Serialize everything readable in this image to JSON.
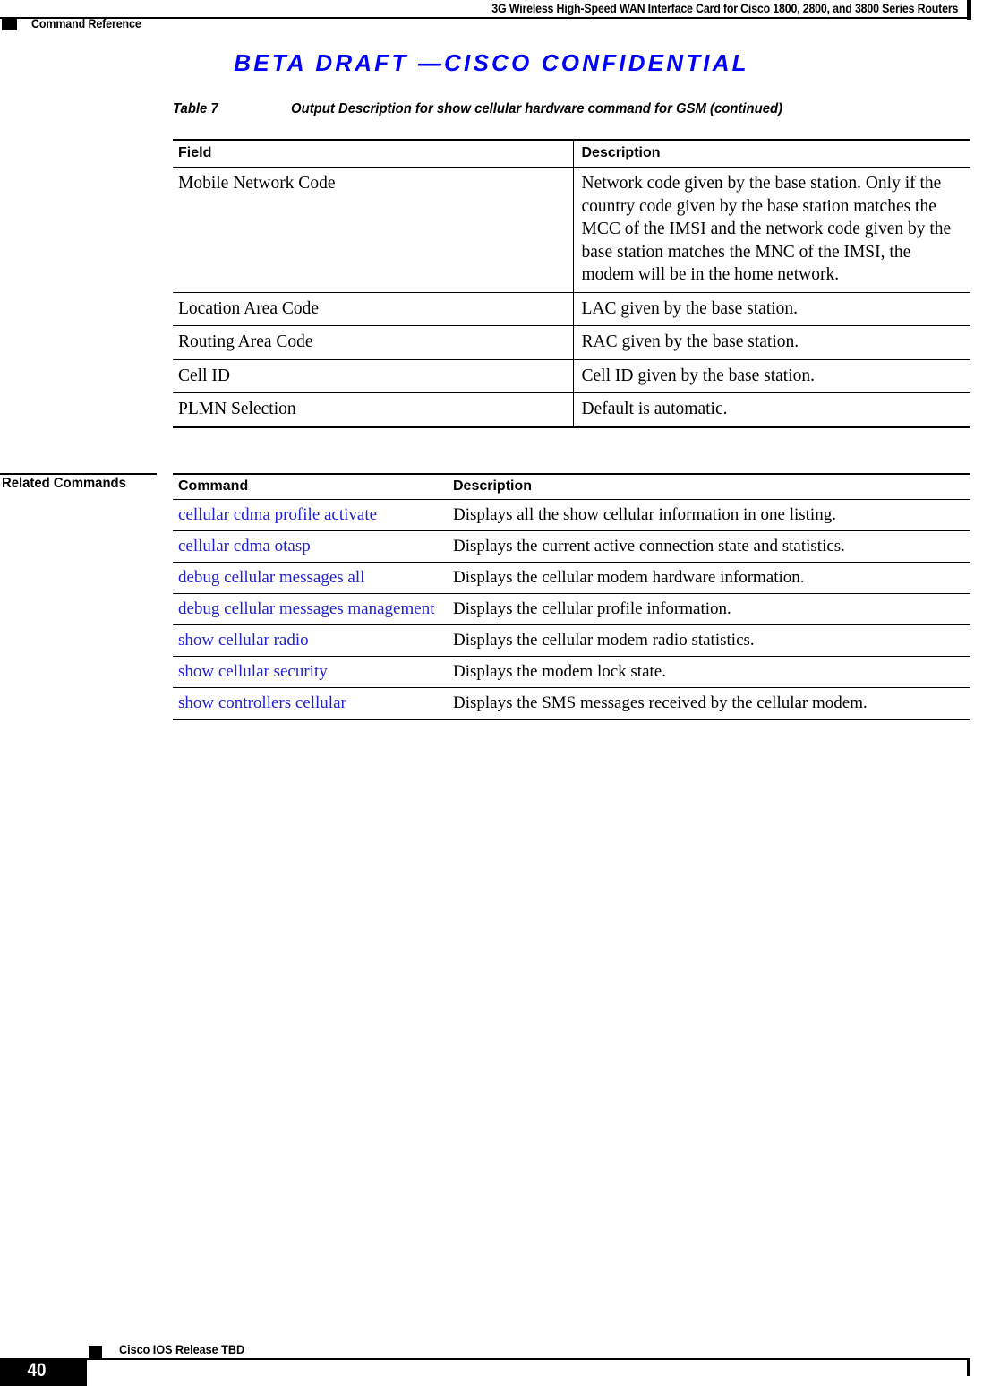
{
  "header": {
    "document_title": "3G Wireless High-Speed WAN Interface Card for Cisco 1800, 2800, and 3800 Series Routers",
    "chapter_label": "Command Reference"
  },
  "banner": {
    "text": "BETA DRAFT —CISCO CONFIDENTIAL",
    "color": "#0000FF"
  },
  "table_caption": {
    "number": "Table 7",
    "title": "Output Description for show cellular hardware command for GSM (continued)"
  },
  "field_table": {
    "columns": [
      "Field",
      "Description"
    ],
    "rows": [
      {
        "field": "Mobile Network Code",
        "description": "Network code given by the base station. Only if the country code given by the base station matches the MCC of the IMSI and the network code given by the base station matches the MNC of the IMSI, the modem will be in the home network."
      },
      {
        "field": "Location Area Code",
        "description": "LAC given by the base station."
      },
      {
        "field": "Routing Area Code",
        "description": "RAC given by the base station."
      },
      {
        "field": "Cell ID",
        "description": "Cell ID given by the base station."
      },
      {
        "field": "PLMN Selection",
        "description": "Default is automatic."
      }
    ]
  },
  "related_commands": {
    "section_label": "Related Commands",
    "columns": [
      "Command",
      "Description"
    ],
    "link_color": "#2222CC",
    "rows": [
      {
        "command": "cellular cdma profile activate",
        "description": "Displays all the show cellular information in one listing."
      },
      {
        "command": "cellular cdma otasp",
        "description": "Displays the current active connection state and statistics."
      },
      {
        "command": "debug cellular messages all",
        "description": "Displays the cellular modem hardware information."
      },
      {
        "command": "debug cellular messages management",
        "description": "Displays the cellular profile information."
      },
      {
        "command": "show cellular radio",
        "description": "Displays the cellular modem radio statistics."
      },
      {
        "command": "show cellular security",
        "description": "Displays the modem lock state."
      },
      {
        "command": "show controllers cellular",
        "description": "Displays the SMS messages received by the cellular modem."
      }
    ]
  },
  "footer": {
    "page_number": "40",
    "release": "Cisco IOS Release TBD"
  }
}
